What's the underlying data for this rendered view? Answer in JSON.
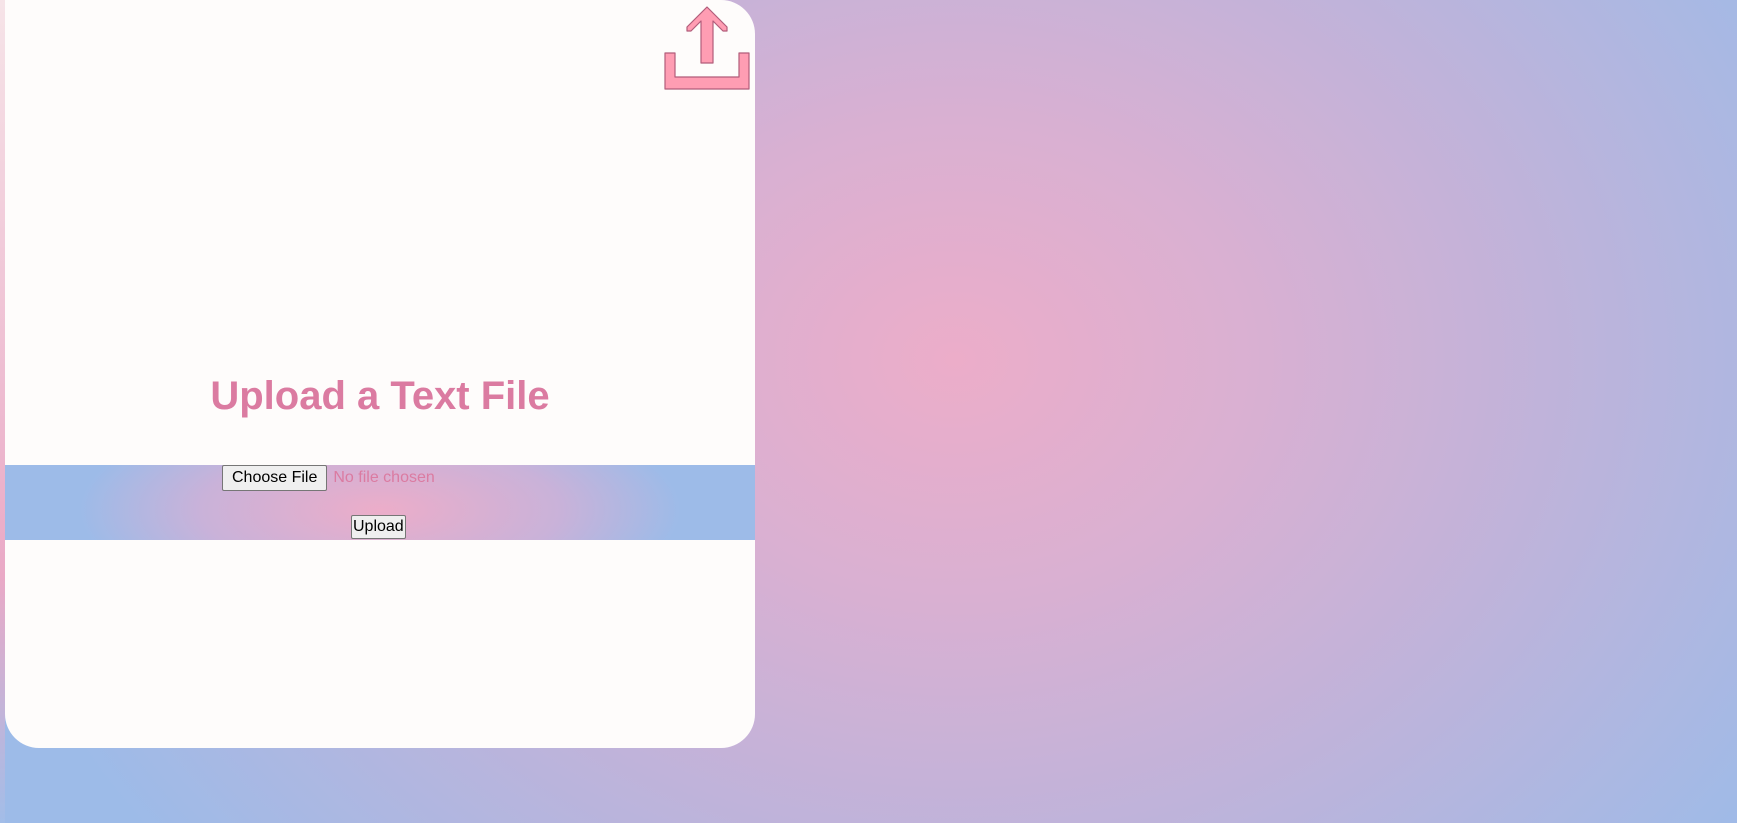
{
  "page": {
    "title": "Upload a Text File"
  },
  "form": {
    "choose_file_label": "Choose File",
    "file_status": "No file chosen",
    "upload_label": "Upload"
  },
  "icons": {
    "upload": "upload-tray-arrow-icon"
  },
  "colors": {
    "accent_pink": "#db7ba1",
    "icon_pink": "#ff9db3",
    "card_bg": "#fefcfb",
    "gradient_pink": "#ecadc9",
    "gradient_blue": "#9dbbe8"
  }
}
